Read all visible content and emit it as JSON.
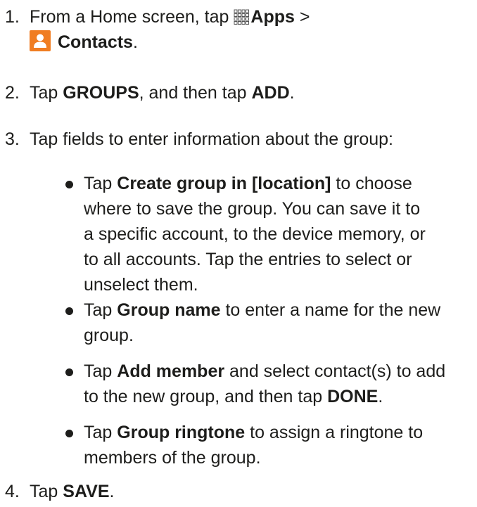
{
  "steps": [
    {
      "number": "1.",
      "line1_pre": "From a Home screen, tap ",
      "apps_label": "Apps",
      "line1_post": " >",
      "contacts_label": "Contacts",
      "line2_post": "."
    },
    {
      "number": "2.",
      "pre": "Tap ",
      "groups": "GROUPS",
      "mid": ", and then tap ",
      "add": "ADD",
      "post": "."
    },
    {
      "number": "3.",
      "text": "Tap fields to enter information about the group:"
    },
    {
      "number": "4.",
      "pre": "Tap ",
      "save": "SAVE",
      "post": "."
    }
  ],
  "bullets": [
    {
      "pre": "Tap ",
      "bold": "Create group in [location]",
      "post_line1": " to choose",
      "line2": "where to save the group. You can save it to",
      "line3": "a specific account, to the device memory, or",
      "line4": "to all accounts. Tap the entries to select or",
      "line5": "unselect them."
    },
    {
      "pre": "Tap ",
      "bold": "Group name",
      "post_line1": " to enter a name for the new",
      "line2": "group."
    },
    {
      "pre": "Tap ",
      "bold": "Add member",
      "post_line1": " and select contact(s) to add",
      "line2_pre": "to the new group, and then tap ",
      "line2_bold": "DONE",
      "line2_post": "."
    },
    {
      "pre": "Tap ",
      "bold": "Group ringtone",
      "post_line1": " to assign a ringtone to",
      "line2": "members of the group."
    }
  ],
  "icons": {
    "apps": "apps-grid-icon",
    "contacts": "contacts-icon",
    "contacts_color": "#f07d22",
    "apps_color": "#555555"
  }
}
